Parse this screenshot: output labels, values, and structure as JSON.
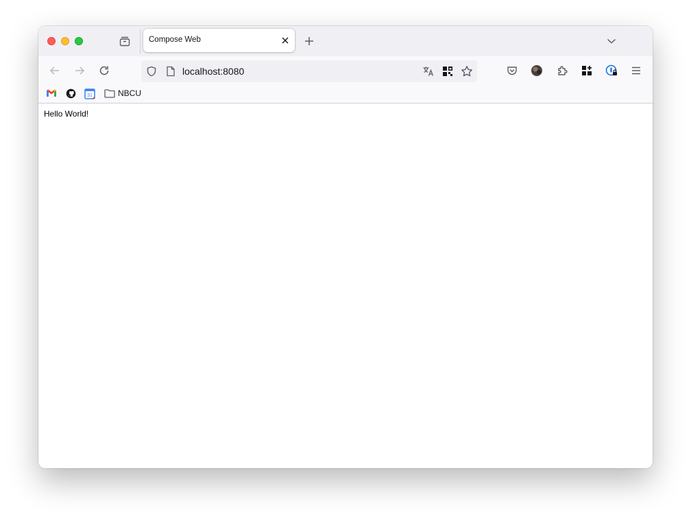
{
  "window": {
    "tab": {
      "title": "Compose Web",
      "close_icon": "close-icon"
    },
    "tabstrip": {
      "icons": [
        "tab-manager-icon",
        "new-tab-plus-icon",
        "tab-list-chevron-icon"
      ]
    },
    "navbar": {
      "back_icon": "arrow-left-icon",
      "forward_icon": "arrow-right-icon",
      "reload_icon": "reload-icon",
      "url": "localhost:8080",
      "url_icons": [
        "shield-icon",
        "page-icon",
        "translate-icon",
        "qr-code-icon",
        "star-icon"
      ],
      "toolbar_icons": [
        "pocket-icon",
        "account-avatar-icon",
        "extensions-puzzle-icon",
        "apps-grid-icon",
        "password-manager-icon",
        "menu-icon"
      ]
    },
    "bookmarks": {
      "items": [
        {
          "label": "",
          "icon": "gmail-icon"
        },
        {
          "label": "",
          "icon": "github-icon"
        },
        {
          "label": "",
          "icon": "calendar-icon",
          "icon_text": "31"
        },
        {
          "label": "NBCU",
          "icon": "folder-icon"
        }
      ]
    },
    "content": {
      "text": "Hello World!"
    }
  },
  "colors": {
    "tabstrip_bg": "#f0f0f4",
    "toolbar_bg": "#f9f9fb",
    "traffic_red": "#ff5f57",
    "traffic_yellow": "#febc2e",
    "traffic_green": "#28c840",
    "icon": "#5b5b66"
  }
}
